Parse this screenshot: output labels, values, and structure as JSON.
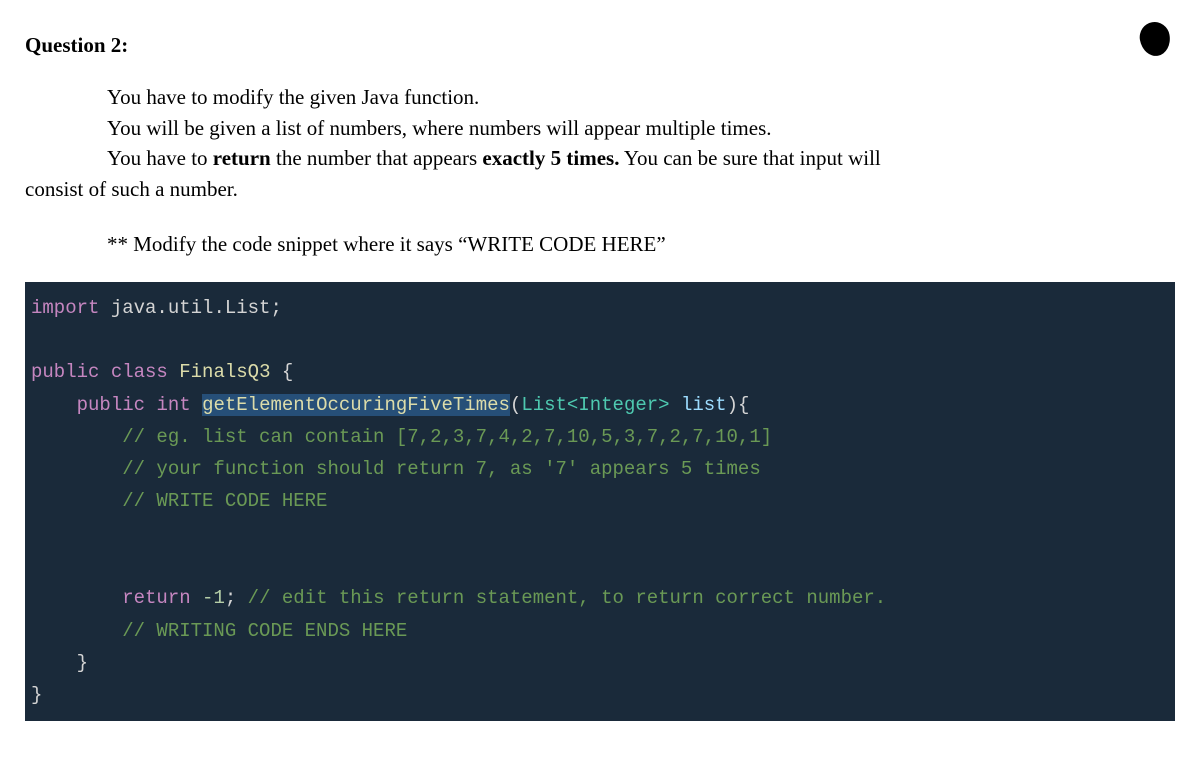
{
  "header": "Question 2:",
  "instructions": {
    "line1": "You have to modify the given Java function.",
    "line2": "You will be given a list of numbers, where numbers will appear multiple times.",
    "line3_part1": "You have to ",
    "line3_bold1": "return",
    "line3_part2": " the number that appears ",
    "line3_bold2": "exactly 5 times.",
    "line3_part3": " You can be sure that input will",
    "line4": "consist of such a number."
  },
  "modify_note": "** Modify the code snippet where it says “WRITE CODE HERE”",
  "code": {
    "import_kw": "import",
    "import_pkg": " java.util.List;",
    "public_kw": "public",
    "class_kw": "class",
    "class_name": "FinalsQ3",
    "brace_open": " {",
    "method_public": "public",
    "method_int": "int",
    "method_name": "getElementOccuringFiveTimes",
    "method_paren_open": "(",
    "param_type": "List<Integer>",
    "param_name": " list",
    "method_paren_close": "){",
    "comment1": "// eg. list can contain [7,2,3,7,4,2,7,10,5,3,7,2,7,10,1]",
    "comment2": "// your function should return 7, as '7' appears 5 times",
    "comment3": "// WRITE CODE HERE",
    "return_kw": "return",
    "return_val": " -1",
    "return_semi": ";",
    "return_comment": " // edit this return statement, to return correct number.",
    "comment4": "// WRITING CODE ENDS HERE",
    "method_close": "}",
    "class_close": "}"
  }
}
